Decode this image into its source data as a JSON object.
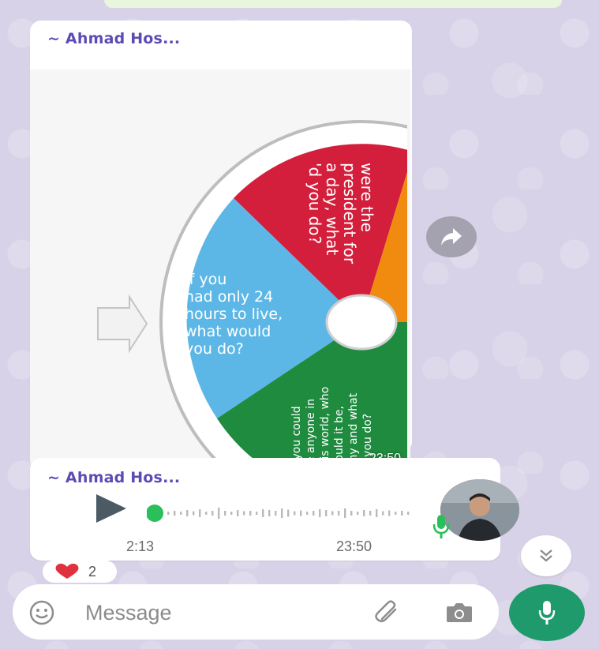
{
  "colors": {
    "sender": "#5b4bb4",
    "accent_green": "#1f9a6c",
    "wedge_red": "#d41f3c",
    "wedge_blue": "#5db7e6",
    "wedge_green": "#1f8b3f",
    "wedge_orange": "#f08b10"
  },
  "image_message": {
    "sender": "~ Ahmad Hos...",
    "time": "23:50",
    "wheel": {
      "red_text": [
        "were the",
        "president for",
        "a day, what",
        "'d you do?"
      ],
      "blue_text": [
        "If you",
        "had only 24",
        "hours to live,",
        "what would",
        "you do?"
      ],
      "green_text": [
        "If you could",
        "be anyone in",
        "this world, who",
        "would it be,",
        "why and what",
        "'d you do?"
      ]
    }
  },
  "voice_message": {
    "sender": "~ Ahmad Hos...",
    "duration": "2:13",
    "time": "23:50",
    "progress": 0.0
  },
  "reaction": {
    "emoji": "heart",
    "count": "2"
  },
  "composer": {
    "placeholder": "Message"
  },
  "icons": {
    "forward": "forward-icon",
    "scroll_down": "double-chevron-down-icon",
    "emoji": "emoji-icon",
    "attach": "paperclip-icon",
    "camera": "camera-icon",
    "mic": "microphone-icon",
    "play": "play-icon"
  }
}
